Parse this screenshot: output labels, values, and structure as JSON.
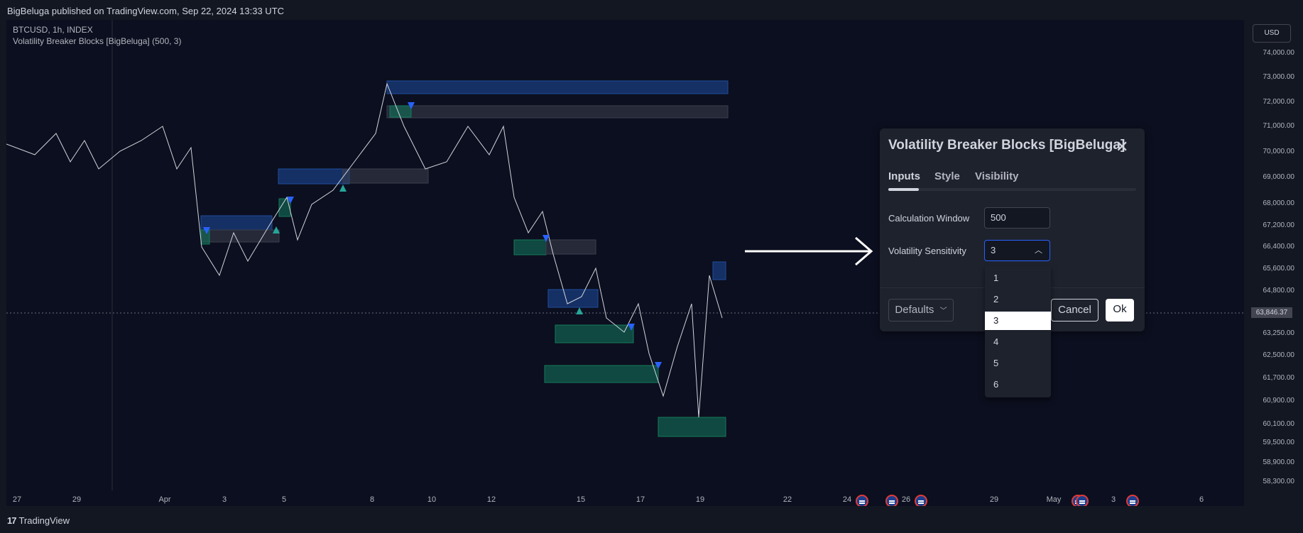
{
  "header": {
    "publish_text": "BigBeluga published on TradingView.com, Sep 22, 2024 13:33 UTC"
  },
  "legend": {
    "symbol": "BTCUSD, 1h, INDEX",
    "indicator": "Volatility Breaker Blocks [BigBeluga] (500, 3)"
  },
  "price_axis": {
    "currency": "USD",
    "labels": [
      "74,000.00",
      "73,000.00",
      "72,000.00",
      "71,000.00",
      "70,000.00",
      "69,000.00",
      "68,000.00",
      "67,200.00",
      "66,400.00",
      "65,600.00",
      "64,800.00",
      "63,846.37",
      "63,250.00",
      "62,500.00",
      "61,700.00",
      "60,900.00",
      "60,100.00",
      "59,500.00",
      "58,900.00",
      "58,300.00"
    ],
    "current_price": "63,846.37"
  },
  "time_axis": {
    "labels": [
      "27",
      "29",
      "Apr",
      "3",
      "5",
      "8",
      "10",
      "12",
      "15",
      "17",
      "19",
      "22",
      "24",
      "26",
      "29",
      "May",
      "3",
      "6"
    ]
  },
  "dialog": {
    "title": "Volatility Breaker Blocks [BigBeluga]",
    "tabs": [
      "Inputs",
      "Style",
      "Visibility"
    ],
    "active_tab": "Inputs",
    "fields": [
      {
        "label": "Calculation Window",
        "value": "500"
      },
      {
        "label": "Volatility Sensitivity",
        "value": "3"
      }
    ],
    "dropdown_options": [
      "1",
      "2",
      "3",
      "4",
      "5",
      "6"
    ],
    "selected_option": "3",
    "buttons": {
      "defaults": "Defaults",
      "cancel": "Cancel",
      "ok": "Ok"
    }
  },
  "footer": {
    "brand": "TradingView"
  },
  "colors": {
    "bearish_block": "#1e4c9c",
    "bullish_block": "#137a5c",
    "neutral_block": "#3a3f4c",
    "accent": "#2962ff",
    "background": "#0c0f1f"
  },
  "icons": [
    "close-icon",
    "chevron-up-icon",
    "chevron-down-icon",
    "arrow-right-icon",
    "economic-event-icon",
    "tradingview-logo-icon"
  ]
}
